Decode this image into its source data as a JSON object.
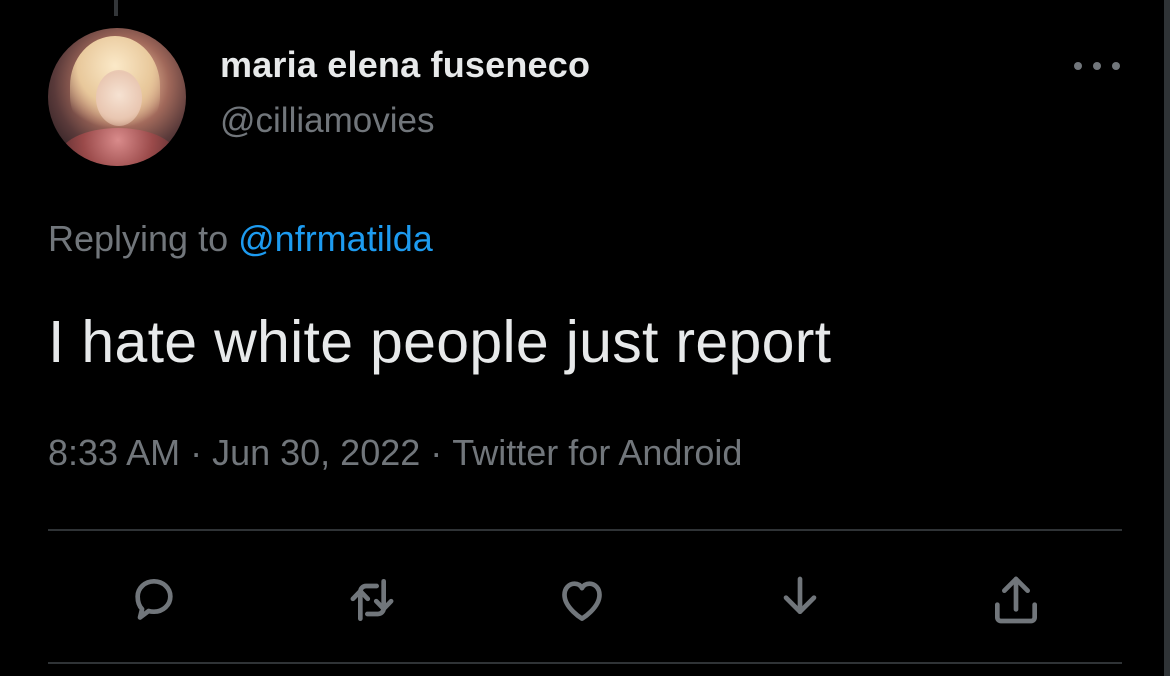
{
  "tweet": {
    "display_name": "maria elena fuseneco",
    "handle": "@cilliamovies",
    "replying_prefix": "Replying to",
    "replying_to": "@nfrmatilda",
    "text": "I hate white people just report",
    "time": "8:33 AM",
    "date": "Jun 30, 2022",
    "source": "Twitter for Android",
    "separator": "·"
  },
  "actions": [
    {
      "name": "reply",
      "icon": "reply-icon"
    },
    {
      "name": "retweet",
      "icon": "retweet-icon"
    },
    {
      "name": "like",
      "icon": "heart-icon"
    },
    {
      "name": "download",
      "icon": "download-icon"
    },
    {
      "name": "share",
      "icon": "share-icon"
    }
  ],
  "colors": {
    "background": "#000000",
    "primary_text": "#e7e9ea",
    "secondary_text": "#71767b",
    "accent": "#1d9bf0",
    "divider": "#2f3336"
  }
}
